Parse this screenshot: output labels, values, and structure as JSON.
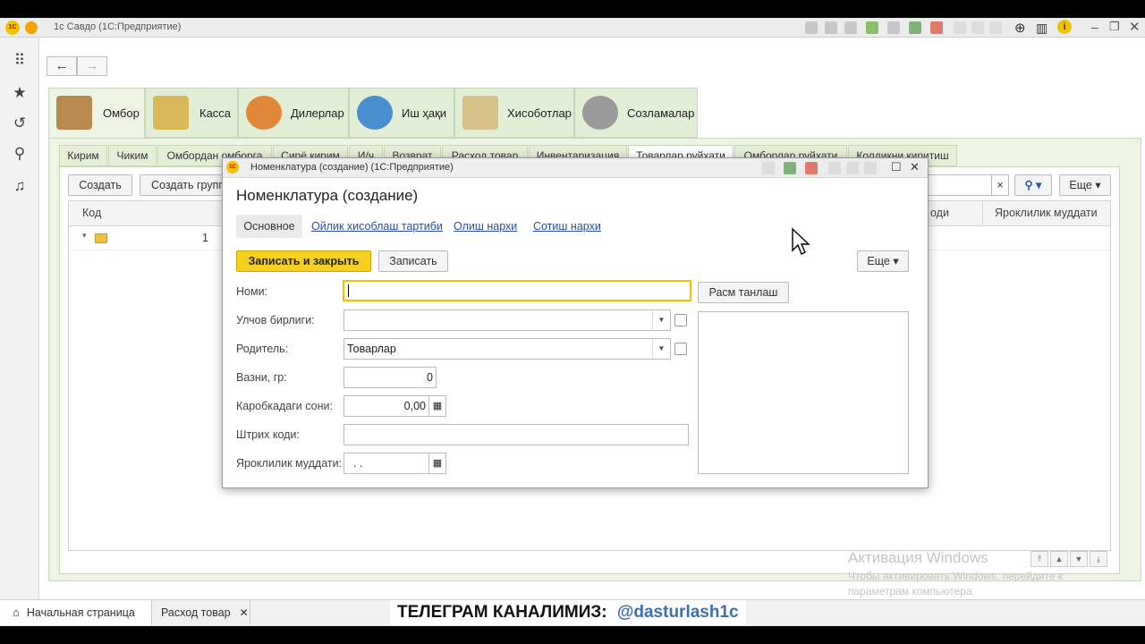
{
  "app": {
    "title": "1с Савдо  (1С:Предприятие)",
    "logo": "1С"
  },
  "main_tabs": [
    {
      "label": "Омбор",
      "icon": "warehouse-icon"
    },
    {
      "label": "Касса",
      "icon": "coins-icon"
    },
    {
      "label": "Дилерлар",
      "icon": "dealer-icon"
    },
    {
      "label": "Иш ҳақи",
      "icon": "people-icon"
    },
    {
      "label": "Хисоботлар",
      "icon": "reports-icon"
    },
    {
      "label": "Созламалар",
      "icon": "gear-icon"
    }
  ],
  "sub_tabs": [
    "Кирим",
    "Чиким",
    "Омбордан омборга",
    "Сирё кирим",
    "И/ч",
    "Возврат",
    "Расход товар",
    "Инвентаризация",
    "Товарлар руйхати",
    "Омборлар руйхати",
    "Колдикни киритиш"
  ],
  "list_toolbar": {
    "create": "Создать",
    "create_group": "Создать группу",
    "clear": "×",
    "search_icon": "search-icon",
    "more": "Еще"
  },
  "grid": {
    "columns": [
      "Код",
      "оди",
      "Яроклилик муддати"
    ],
    "rows": [
      {
        "code": "1"
      }
    ]
  },
  "dialog": {
    "window_title": "Номенклатура (создание)  (1С:Предприятие)",
    "heading": "Номенклатура (создание)",
    "tabs": [
      "Основное",
      "Ойлик хисоблаш тартиби",
      "Олиш нархи",
      "Сотиш нархи"
    ],
    "save_close": "Записать и закрыть",
    "save": "Записать",
    "more": "Еще",
    "choose_image": "Расм танлаш",
    "fields": {
      "name_label": "Номи:",
      "name_value": "",
      "unit_label": "Улчов бирлиги:",
      "unit_value": "",
      "parent_label": "Родитель:",
      "parent_value": "Товарлар",
      "weight_label": "Вазни, гр:",
      "weight_value": "0",
      "box_label": "Каробкадаги сони:",
      "box_value": "0,00",
      "barcode_label": "Штрих коди:",
      "barcode_value": "",
      "expiry_label": "Яроклилик муддати:",
      "expiry_value": ".  ."
    }
  },
  "watermark": {
    "line1": "Активация Windows",
    "line2": "Чтобы активировать Windows, перейдите к параметрам компьютера."
  },
  "bottom_tabs": [
    "Начальная страница",
    "Расход товар"
  ],
  "telegram": {
    "label": "ТЕЛЕГРАМ КАНАЛИМИЗ:",
    "handle": "@dasturlash1c"
  },
  "colors": {
    "accent_yellow": "#f5d020",
    "tab_green": "#e3eed6",
    "link_blue": "#2a4f9a"
  }
}
